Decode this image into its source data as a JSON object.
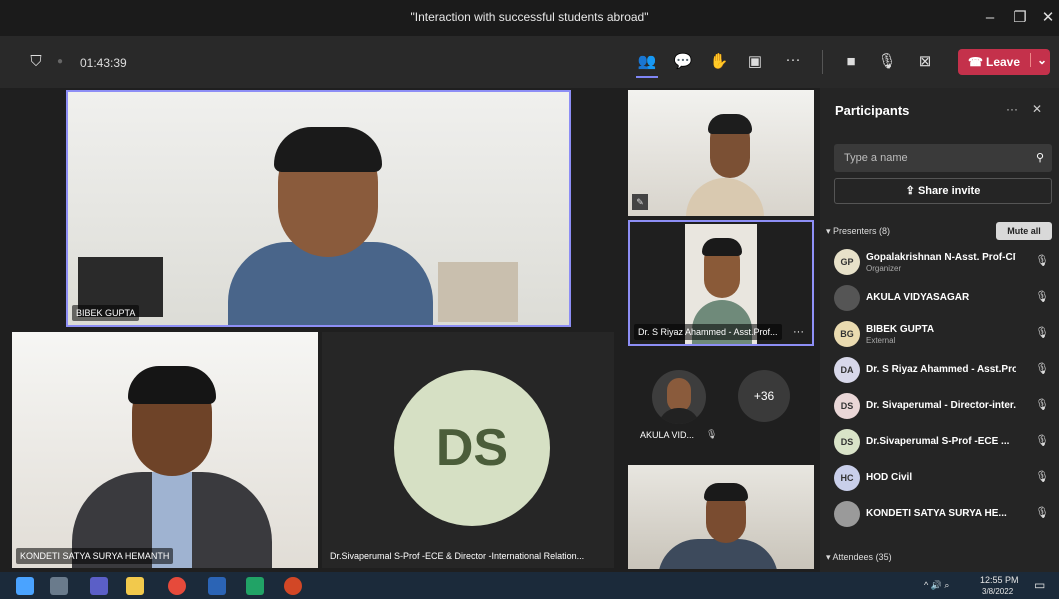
{
  "window": {
    "title": "\"Interaction with successful students abroad\""
  },
  "toolbar": {
    "timer": "01:43:39",
    "leave_label": "Leave"
  },
  "stage": {
    "tiles": [
      {
        "name": "BIBEK GUPTA"
      },
      {
        "name": "Dr. S Riyaz Ahammed - Asst.Prof..."
      },
      {
        "name": "AKULA VID..."
      },
      {
        "name": "KONDETI SATYA SURYA HEMANTH"
      },
      {
        "name": "Dr.Sivaperumal S-Prof -ECE & Director -International Relation...",
        "initials": "DS"
      }
    ],
    "overflow_count": "+36"
  },
  "participants": {
    "title": "Participants",
    "search_placeholder": "Type a name",
    "share_invite": "Share invite",
    "presenters_header": "Presenters (8)",
    "mute_all": "Mute all",
    "attendees_header": "Attendees (35)",
    "list": [
      {
        "initials": "GP",
        "name": "Gopalakrishnan N-Asst. Prof-CIV",
        "role": "Organizer",
        "color": "#e7e1c9"
      },
      {
        "initials": "",
        "name": "AKULA VIDYASAGAR",
        "role": "",
        "color": "#555555"
      },
      {
        "initials": "BG",
        "name": "BIBEK GUPTA",
        "role": "External",
        "color": "#eadbb0"
      },
      {
        "initials": "DA",
        "name": "Dr. S Riyaz Ahammed - Asst.Pro...",
        "role": "",
        "color": "#d8d8ea"
      },
      {
        "initials": "DS",
        "name": "Dr. Sivaperumal - Director-inter...",
        "role": "",
        "color": "#ead7d7"
      },
      {
        "initials": "DS",
        "name": "Dr.Sivaperumal S-Prof -ECE ...",
        "role": "",
        "color": "#d9e3c8"
      },
      {
        "initials": "HC",
        "name": "HOD Civil",
        "role": "",
        "color": "#c9cfea"
      },
      {
        "initials": "",
        "name": "KONDETI SATYA SURYA HE...",
        "role": "",
        "color": "#9a9a9a"
      }
    ]
  },
  "taskbar": {
    "time": "12:55 PM",
    "date": "3/8/2022"
  }
}
